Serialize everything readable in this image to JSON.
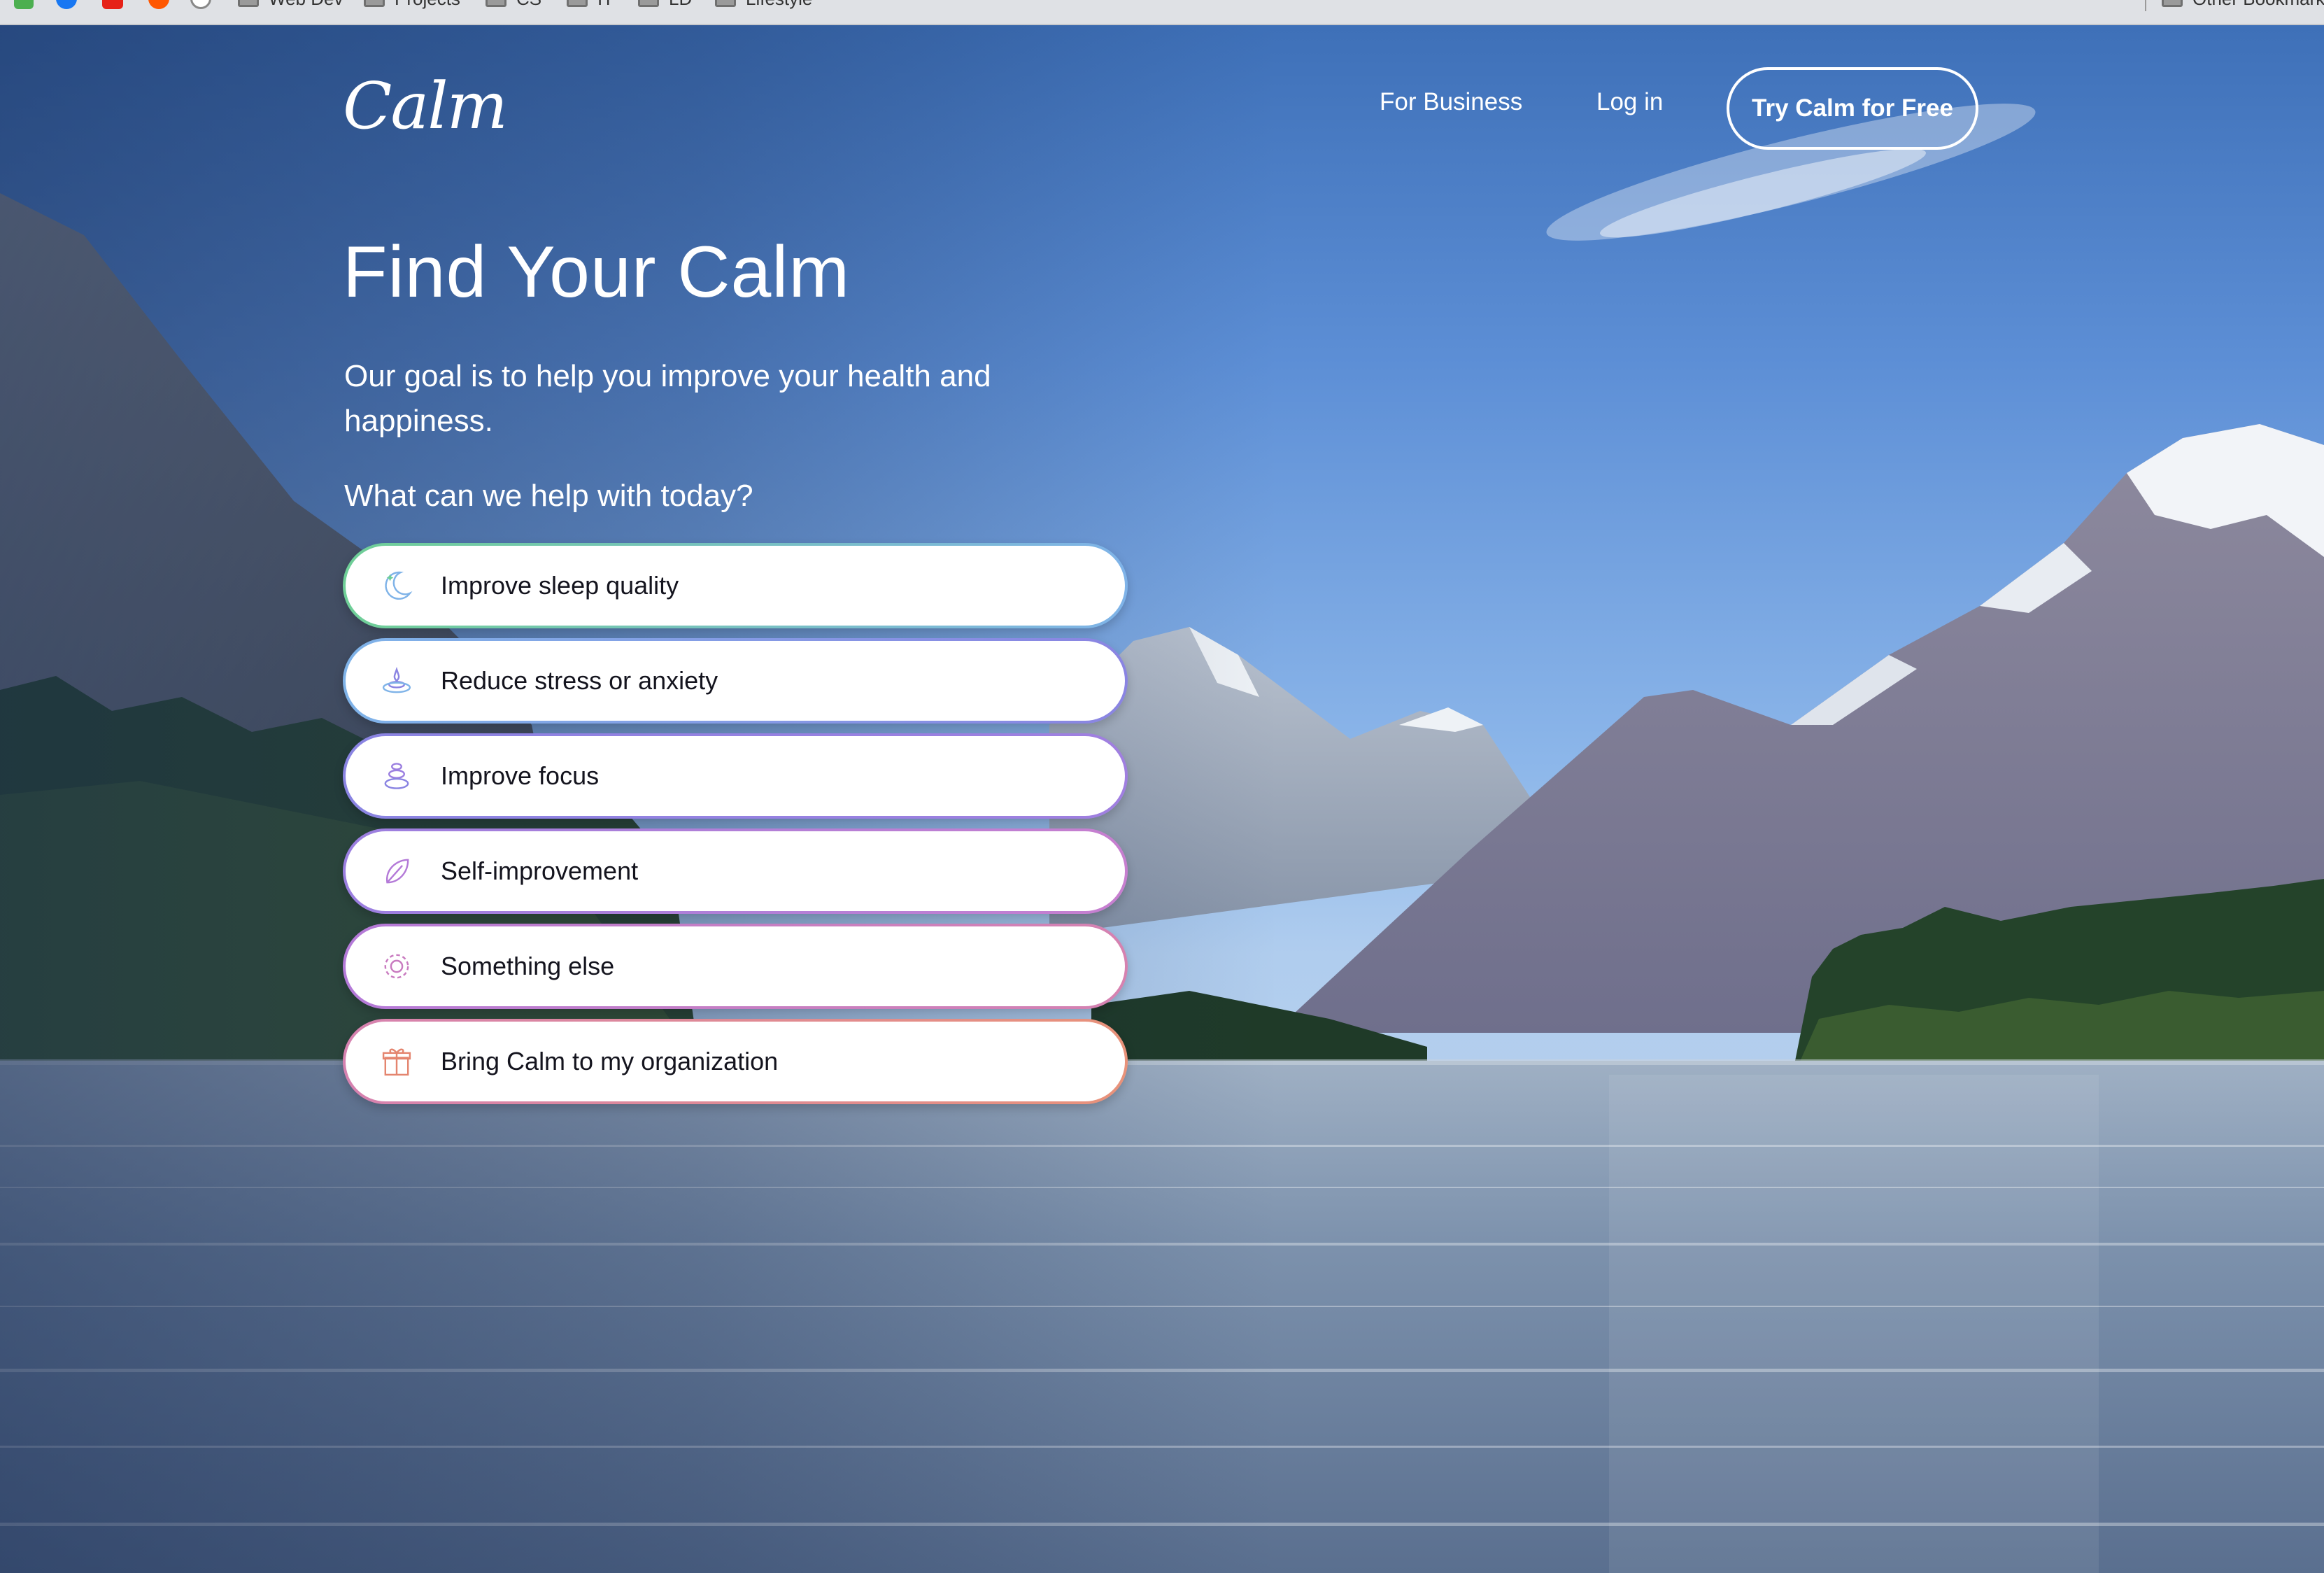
{
  "bookmarks_bar": {
    "items": [
      {
        "label": "Web Dev"
      },
      {
        "label": "Projects"
      },
      {
        "label": "CS"
      },
      {
        "label": "IT"
      },
      {
        "label": "LD"
      },
      {
        "label": "Lifestyle"
      }
    ],
    "other_label": "Other Bookmarks"
  },
  "header": {
    "logo": "Calm",
    "nav": {
      "for_business": "For Business",
      "log_in": "Log in",
      "cta": "Try Calm for Free"
    }
  },
  "hero": {
    "title": "Find Your Calm",
    "subtitle": "Our goal is to help you improve your health and happiness.",
    "prompt": "What can we help with today?"
  },
  "options": [
    {
      "label": "Improve sleep quality",
      "icon": "moon-icon",
      "color": "#6fcf97"
    },
    {
      "label": "Reduce stress or anxiety",
      "icon": "ripple-icon",
      "color": "#8a84e2"
    },
    {
      "label": "Improve focus",
      "icon": "stones-icon",
      "color": "#9b7fe0"
    },
    {
      "label": "Self-improvement",
      "icon": "leaf-icon",
      "color": "#b47ad8"
    },
    {
      "label": "Something else",
      "icon": "flower-icon",
      "color": "#c97bc0"
    },
    {
      "label": "Bring Calm to my organization",
      "icon": "gift-icon",
      "color": "#e4856f"
    }
  ]
}
